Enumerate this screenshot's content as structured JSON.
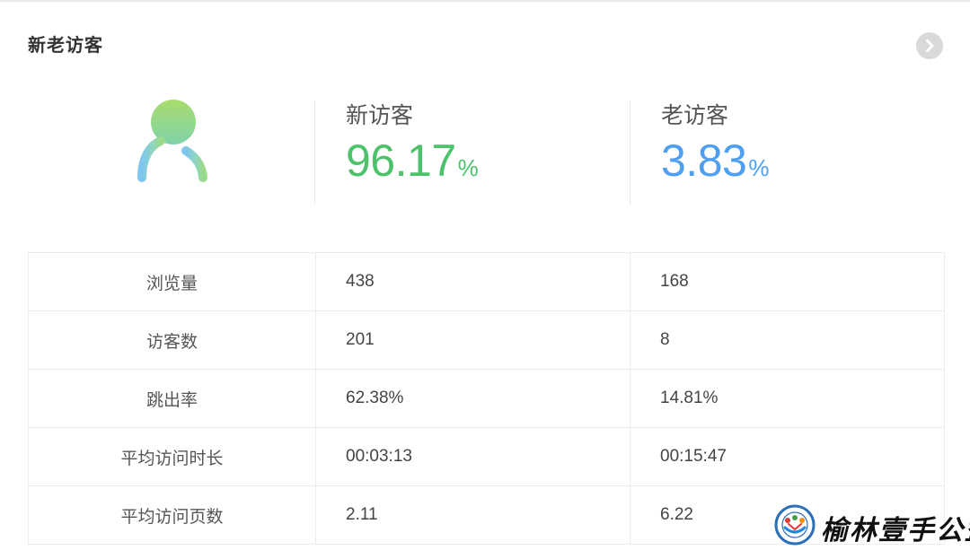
{
  "card": {
    "title": "新老访客",
    "nav_icon": "chevron-right-icon"
  },
  "summary": {
    "avatar_icon": "user-gradient-icon",
    "new_visitor": {
      "label": "新访客",
      "value": "96.17",
      "unit": "%",
      "color": "#4cc26a"
    },
    "returning_visitor": {
      "label": "老访客",
      "value": "3.83",
      "unit": "%",
      "color": "#4e9ff0"
    }
  },
  "metrics": {
    "rows": [
      {
        "label": "浏览量",
        "new": "438",
        "returning": "168"
      },
      {
        "label": "访客数",
        "new": "201",
        "returning": "8"
      },
      {
        "label": "跳出率",
        "new": "62.38%",
        "returning": "14.81%"
      },
      {
        "label": "平均访问时长",
        "new": "00:03:13",
        "returning": "00:15:47"
      },
      {
        "label": "平均访问页数",
        "new": "2.11",
        "returning": "6.22"
      }
    ]
  },
  "watermark": {
    "text": "榆林壹手公益"
  }
}
